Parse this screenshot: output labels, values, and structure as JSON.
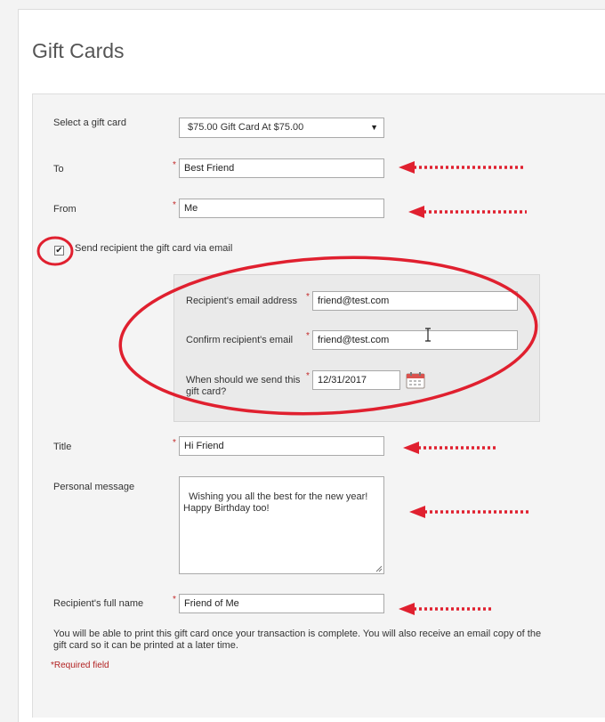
{
  "page": {
    "title": "Gift Cards"
  },
  "form": {
    "select_label": "Select a gift card",
    "select_value": "$75.00 Gift Card At  $75.00",
    "to_label": "To",
    "to_value": "Best Friend",
    "from_label": "From",
    "from_value": "Me",
    "send_email_label": "Send recipient the gift card via email",
    "send_email_checked": true,
    "recipient_email_label": "Recipient's email address",
    "recipient_email_value": "friend@test.com",
    "confirm_email_label": "Confirm recipient's email",
    "confirm_email_value": "friend@test.com",
    "send_date_label": "When should we send this gift card?",
    "send_date_value": "12/31/2017",
    "title_label": "Title",
    "title_value": "Hi Friend",
    "message_label": "Personal message",
    "message_value": "Wishing you all the best for the new year!\nHappy Birthday too!",
    "full_name_label": "Recipient's full name",
    "full_name_value": "Friend of Me",
    "required_marker": "*",
    "print_note": "You will be able to print this gift card once your transaction is complete. You will also receive an email copy of the gift card so it can be printed at a later time.",
    "required_note": "*Required field"
  },
  "icons": {
    "select_caret": "chevron-down-icon",
    "checkbox_mark": "✔",
    "calendar": "calendar-icon",
    "text_cursor": "text-cursor-icon"
  },
  "annotation": {
    "color": "#e0202f"
  }
}
